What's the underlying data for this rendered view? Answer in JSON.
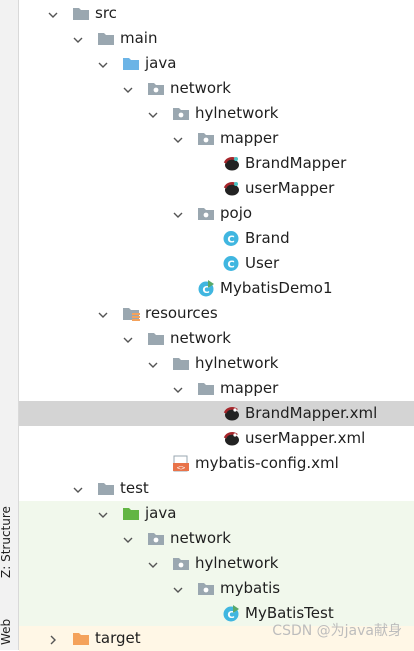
{
  "sidebar": {
    "tabs": [
      {
        "label": "Z: Structure"
      },
      {
        "label": "Web"
      }
    ]
  },
  "tree": {
    "items": [
      {
        "label": "src",
        "icon": "folder-icon"
      },
      {
        "label": "main",
        "icon": "folder-icon"
      },
      {
        "label": "java",
        "icon": "source-root-folder-icon"
      },
      {
        "label": "network",
        "icon": "package-icon"
      },
      {
        "label": "hylnetwork",
        "icon": "package-icon"
      },
      {
        "label": "mapper",
        "icon": "package-icon"
      },
      {
        "label": "BrandMapper",
        "icon": "mybatis-mapper-interface-icon"
      },
      {
        "label": "userMapper",
        "icon": "mybatis-mapper-interface-icon"
      },
      {
        "label": "pojo",
        "icon": "package-icon"
      },
      {
        "label": "Brand",
        "icon": "class-icon"
      },
      {
        "label": "User",
        "icon": "class-icon"
      },
      {
        "label": "MybatisDemo1",
        "icon": "runnable-class-icon"
      },
      {
        "label": "resources",
        "icon": "resources-folder-icon"
      },
      {
        "label": "network",
        "icon": "folder-icon"
      },
      {
        "label": "hylnetwork",
        "icon": "folder-icon"
      },
      {
        "label": "mapper",
        "icon": "folder-icon"
      },
      {
        "label": "BrandMapper.xml",
        "icon": "mybatis-xml-icon"
      },
      {
        "label": "userMapper.xml",
        "icon": "mybatis-xml-icon"
      },
      {
        "label": "mybatis-config.xml",
        "icon": "xml-file-icon"
      },
      {
        "label": "test",
        "icon": "folder-icon"
      },
      {
        "label": "java",
        "icon": "test-source-root-folder-icon"
      },
      {
        "label": "network",
        "icon": "package-icon"
      },
      {
        "label": "hylnetwork",
        "icon": "package-icon"
      },
      {
        "label": "mybatis",
        "icon": "package-icon"
      },
      {
        "label": "MyBatisTest",
        "icon": "runnable-class-icon"
      },
      {
        "label": "target",
        "icon": "excluded-folder-icon"
      }
    ]
  },
  "watermark": "CSDN @为java献身",
  "colors": {
    "selection": "#d4d4d4",
    "test_background": "#f1f8ec",
    "folder": "#9aa7b0",
    "source_root": "#6cb4e6",
    "test_root": "#62b543",
    "target_folder": "#f4a25b",
    "class_icon": "#40b6e0",
    "run_arrow": "#59a869",
    "mybatis_bird": "#a6262b"
  }
}
